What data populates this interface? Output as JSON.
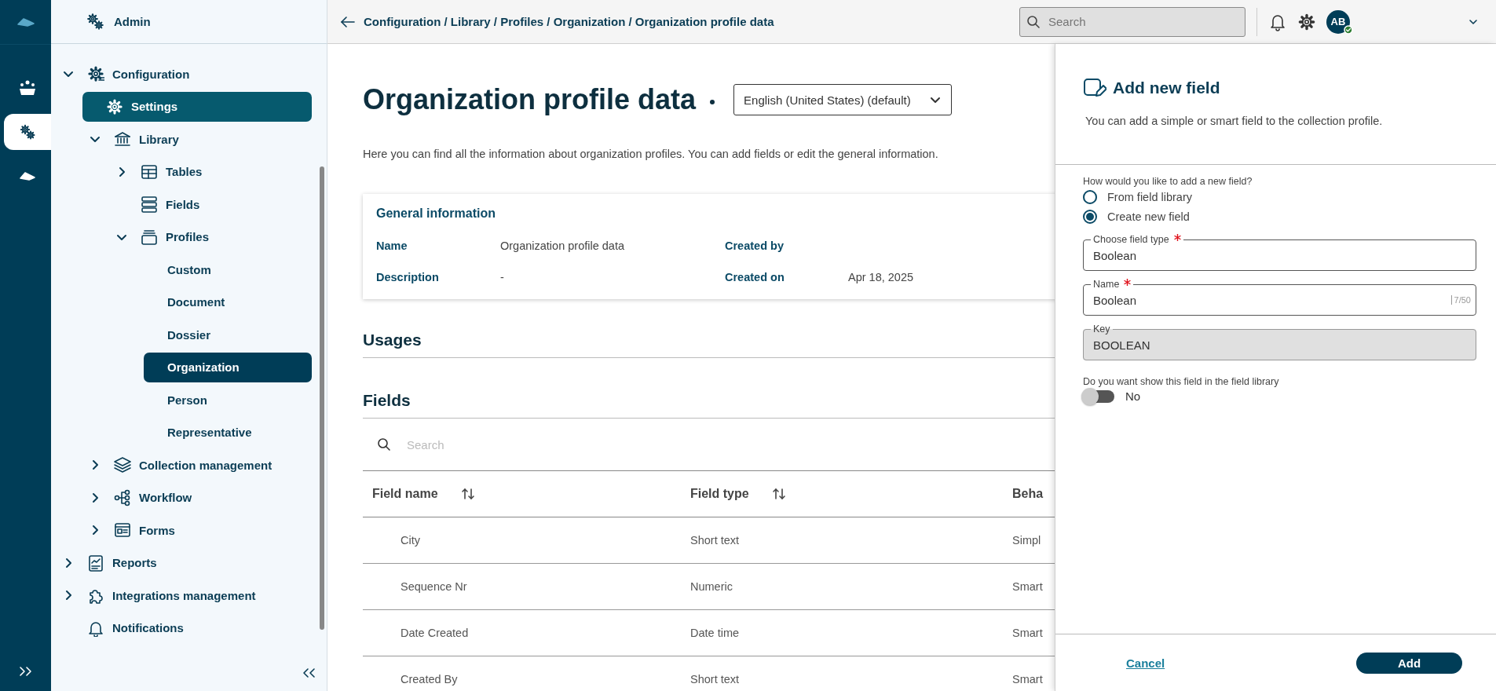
{
  "rail": {
    "items": [
      {
        "selected": false
      },
      {
        "selected": true
      },
      {
        "selected": false
      }
    ]
  },
  "sidebar": {
    "title": "Admin",
    "items": [
      {
        "label": "Configuration",
        "expanded": true,
        "selected": false,
        "highlighted": false,
        "children": [
          {
            "label": "Settings",
            "selected": false,
            "highlighted": true
          },
          {
            "label": "Library",
            "expanded": true,
            "selected": false,
            "highlighted": false,
            "children": [
              {
                "label": "Tables",
                "expanded": false,
                "selected": false,
                "highlighted": false
              },
              {
                "label": "Fields",
                "selected": false,
                "highlighted": false
              },
              {
                "label": "Profiles",
                "expanded": true,
                "selected": false,
                "highlighted": false,
                "children": [
                  {
                    "label": "Custom",
                    "selected": false,
                    "highlighted": false
                  },
                  {
                    "label": "Document",
                    "selected": false,
                    "highlighted": false
                  },
                  {
                    "label": "Dossier",
                    "selected": false,
                    "highlighted": false
                  },
                  {
                    "label": "Organization",
                    "selected": true,
                    "highlighted": false
                  },
                  {
                    "label": "Person",
                    "selected": false,
                    "highlighted": false
                  },
                  {
                    "label": "Representative",
                    "selected": false,
                    "highlighted": false
                  }
                ]
              }
            ]
          },
          {
            "label": "Collection management",
            "expanded": false,
            "selected": false,
            "highlighted": false
          },
          {
            "label": "Workflow",
            "expanded": false,
            "selected": false,
            "highlighted": false
          },
          {
            "label": "Forms",
            "expanded": false,
            "selected": false,
            "highlighted": false
          }
        ]
      },
      {
        "label": "Reports",
        "expanded": false,
        "selected": false,
        "highlighted": false
      },
      {
        "label": "Integrations management",
        "expanded": false,
        "selected": false,
        "highlighted": false
      },
      {
        "label": "Notifications",
        "selected": false,
        "highlighted": false
      }
    ]
  },
  "header": {
    "breadcrumb": "Configuration / Library / Profiles / Organization / Organization profile data",
    "search": {
      "placeholder": "Search"
    },
    "avatar": "AB",
    "online": true
  },
  "page": {
    "title": "Organization profile data",
    "unsaved": true,
    "language": "English (United States) (default)",
    "description": "Here you can find all the information about organization profiles. You can add fields or edit the general information.",
    "general_information": {
      "title": "General information",
      "fields": [
        {
          "label": "Name",
          "value": "Organization profile data"
        },
        {
          "label": "Created by"
        },
        {
          "label": "Description",
          "value": "-"
        },
        {
          "label": "Created on",
          "value": "Apr 18, 2025"
        }
      ]
    },
    "usages": {
      "title": "Usages"
    },
    "fields": {
      "title": "Fields",
      "search": {
        "placeholder": "Search"
      },
      "table": {
        "columns": [
          {
            "label": "Field name",
            "sortable": true
          },
          {
            "label": "Field type",
            "sortable": true
          },
          {
            "label": "Beha",
            "sortable": false
          }
        ],
        "rows": [
          [
            "City",
            "Short text",
            "Simpl"
          ],
          [
            "Sequence Nr",
            "Numeric",
            "Smart"
          ],
          [
            "Date Created",
            "Date time",
            "Smart"
          ],
          [
            "Created By",
            "Short text",
            "Smart"
          ]
        ]
      }
    }
  },
  "drawer": {
    "title": "Add new field",
    "subtitle": "You can add a simple or smart field to the collection profile.",
    "question": "How would you like to add a new field?",
    "options": [
      {
        "label": "From field library",
        "selected": false
      },
      {
        "label": "Create new field",
        "selected": true
      }
    ],
    "inputs": [
      {
        "label": "Choose field type",
        "required": true,
        "value": "Boolean",
        "disabled": false
      },
      {
        "label": "Name",
        "required": true,
        "value": "Boolean",
        "counter": "7/50",
        "disabled": false
      },
      {
        "label": "Key",
        "required": false,
        "value": "BOOLEAN",
        "disabled": true
      }
    ],
    "toggle": {
      "label": "Do you want show this field in the field library",
      "on": false,
      "state_label": "No"
    },
    "cancel": "Cancel",
    "add": "Add"
  }
}
